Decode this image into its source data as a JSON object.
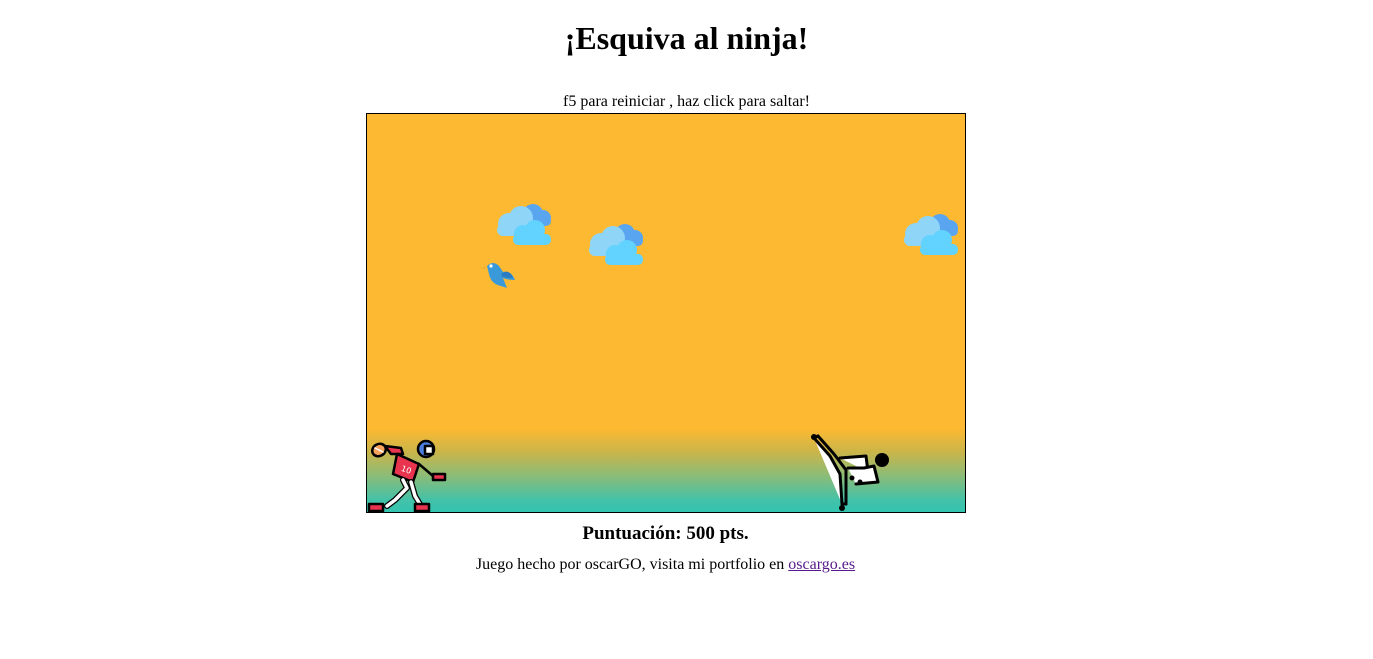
{
  "page": {
    "title": "¡Esquiva al ninja!",
    "instructions": "f5 para reiniciar , haz click para saltar!"
  },
  "game": {
    "colors": {
      "sky": "#fdb931",
      "ground": "#33c4b0",
      "cloud_front": "#6dd8ff",
      "cloud_back": "#5aa5f0",
      "bird": "#3a9ad9",
      "player_jersey": "#e8344e",
      "player_helmet": "#4a7fe0"
    },
    "sprites": {
      "clouds": [
        "cloud-icon",
        "cloud-icon",
        "cloud-icon"
      ],
      "bird": "bird-icon",
      "player": "football-player-icon",
      "enemy": "ninja-kick-icon"
    }
  },
  "score": {
    "label": "Puntuación: 500 pts."
  },
  "footer": {
    "text": "Juego hecho por oscarGO, visita mi portfolio en ",
    "link_text": "oscargo.es"
  }
}
